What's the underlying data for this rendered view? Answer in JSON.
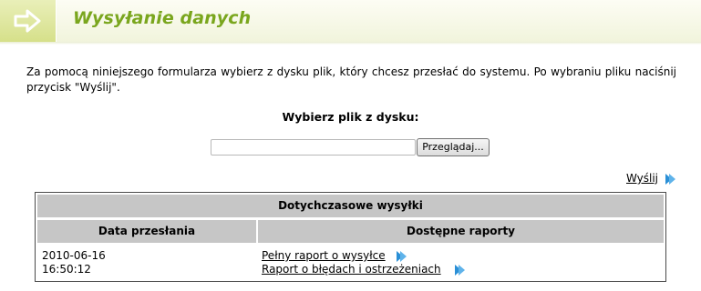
{
  "header": {
    "title": "Wysyłanie danych",
    "icon": "arrow-right-icon",
    "accent_color": "#7aa61e"
  },
  "intro": {
    "text": "Za pomocą niniejszego formularza wybierz z dysku plik, który chcesz przesłać do systemu. Po wybraniu pliku naciśnij przycisk \"Wyślij\"."
  },
  "upload": {
    "label": "Wybierz plik z dysku:",
    "file_value": "",
    "browse_label": "Przeglądaj...",
    "send_label": "Wyślij"
  },
  "history": {
    "title": "Dotychczasowe wysyłki",
    "columns": [
      "Data przesłania",
      "Dostępne raporty"
    ],
    "rows": [
      {
        "date": "2010-06-16",
        "time": "16:50:12",
        "reports": [
          "Pełny raport o wysyłce",
          "Raport o błędach i ostrzeżeniach"
        ]
      }
    ]
  },
  "colors": {
    "link_arrow": "#2a8fd6",
    "table_header_bg": "#c6c6c6"
  }
}
